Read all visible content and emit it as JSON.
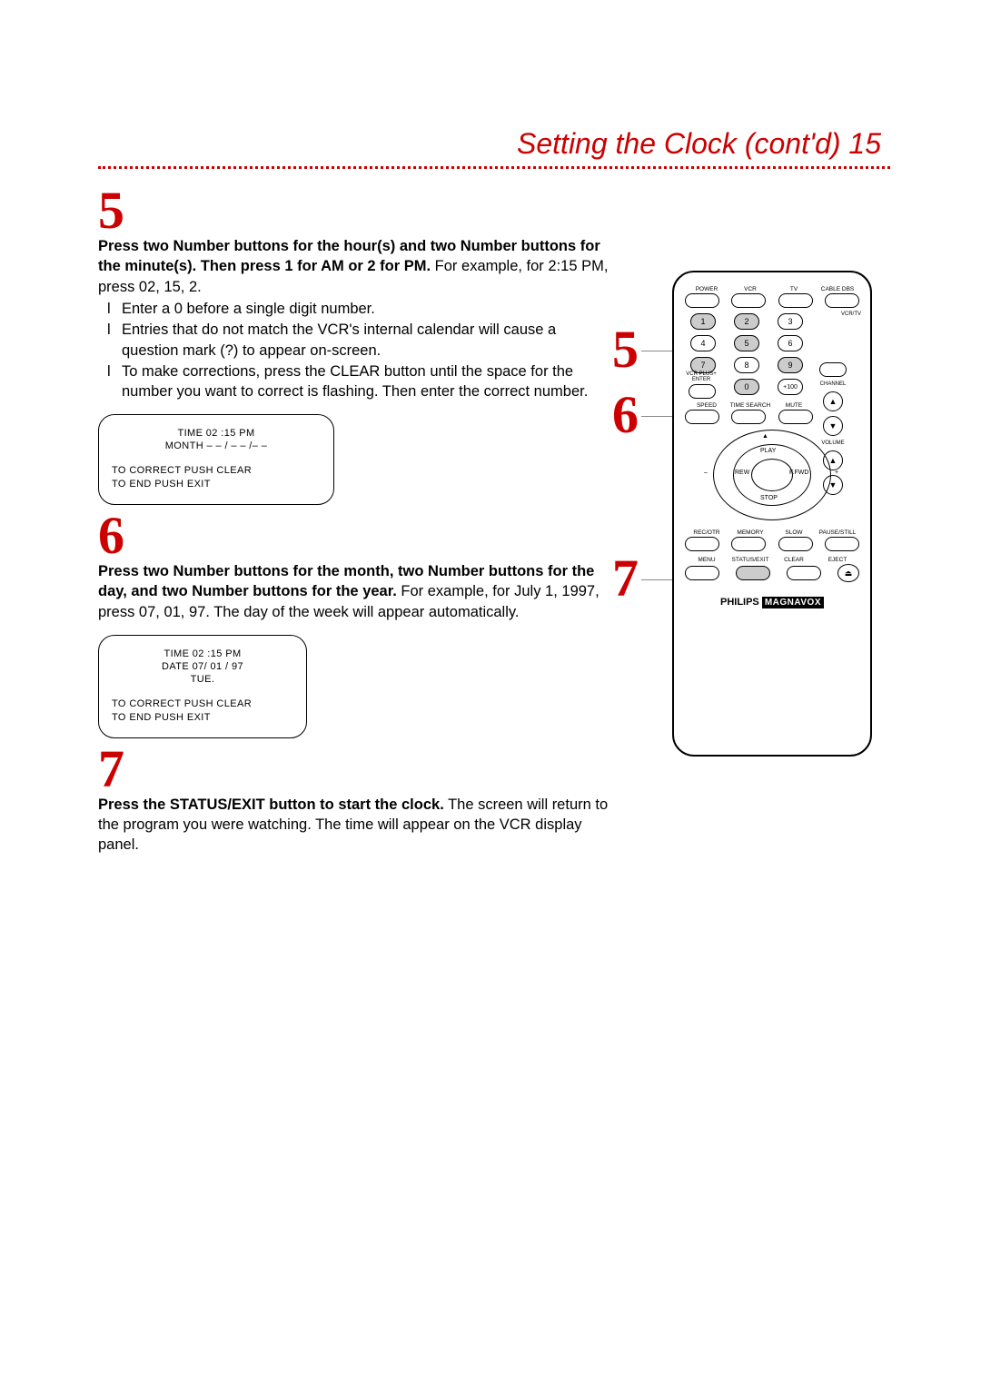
{
  "page": {
    "title": "Setting the Clock (cont'd) 15"
  },
  "step5": {
    "num": "5",
    "bold": "Press two Number buttons for the hour(s) and two Number buttons for the minute(s). Then press 1 for AM or 2 for PM.",
    "rest": " For example, for 2:15 PM, press 02, 15, 2.",
    "bul1": "Enter a 0 before a single digit number.",
    "bul2": "Entries that do not match the VCR's internal calendar will cause a question mark (?) to appear on-screen.",
    "bul3": "To make corrections, press the CLEAR button until the space for the number you want to correct is flashing. Then enter the correct number.",
    "osd_l1": "TIME 02 :15 PM",
    "osd_l2": "MONTH – – / – – /– –",
    "osd_b1": "TO CORRECT PUSH CLEAR",
    "osd_b2": "TO END PUSH EXIT"
  },
  "step6": {
    "num": "6",
    "bold": "Press two Number buttons for the month, two Number buttons for the day, and two Number buttons for the year.",
    "rest": " For example, for July 1, 1997, press 07, 01, 97. The day of the week will appear automatically.",
    "osd_l1": "TIME 02 :15 PM",
    "osd_l2": "DATE 07/ 01 / 97",
    "osd_l3": "TUE.",
    "osd_b1": "TO CORRECT PUSH CLEAR",
    "osd_b2": "TO END PUSH EXIT"
  },
  "step7": {
    "num": "7",
    "bold": "Press the STATUS/EXIT button to start the clock.",
    "rest": " The screen will return to the program you were watching. The time will appear on the VCR display panel."
  },
  "remote": {
    "top": {
      "power": "POWER",
      "vcr": "VCR",
      "tv": "TV",
      "cable": "CABLE DBS"
    },
    "vcrtv": "VCR/TV",
    "channel": "CHANNEL",
    "volume": "VOLUME",
    "nums": {
      "n1": "1",
      "n2": "2",
      "n3": "3",
      "n4": "4",
      "n5": "5",
      "n6": "6",
      "n7": "7",
      "n8": "8",
      "n9": "9",
      "n0": "0",
      "n100": "+100",
      "vcrplus": "VCR PLUS+ ENTER"
    },
    "row4lbl": {
      "speed": "SPEED",
      "timesearch": "TIME SEARCH",
      "mute": "MUTE"
    },
    "dpad": {
      "play": "PLAY",
      "stop": "STOP",
      "rew": "REW",
      "ffwd": "F.FWD",
      "minus": "–",
      "plus": "+",
      "up": "▲"
    },
    "row5lbl": {
      "recotr": "REC/OTR",
      "memory": "MEMORY",
      "slow": "SLOW",
      "pause": "PAUSE/STILL"
    },
    "row6lbl": {
      "menu": "MENU",
      "status": "STATUS/EXIT",
      "clear": "CLEAR",
      "eject": "EJECT"
    },
    "brand1": "PHILIPS",
    "brand2": "MAGNAVOX"
  }
}
